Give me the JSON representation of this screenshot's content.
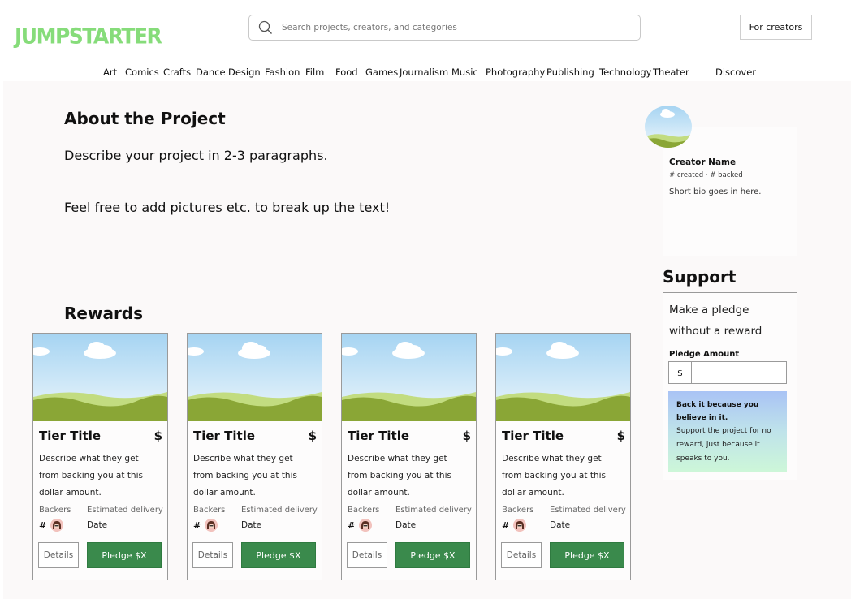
{
  "brand": {
    "logo": "JUMPSTARTER",
    "logo_color": "#86dc7a"
  },
  "search": {
    "placeholder": "Search projects, creators, and categories"
  },
  "header": {
    "creators_button": "For creators"
  },
  "nav": {
    "categories": [
      "Art",
      "Comics",
      "Crafts",
      "Dance",
      "Design",
      "Fashion",
      "Film",
      "Food",
      "Games",
      "Journalism",
      "Music",
      "Photography",
      "Publishing",
      "Technology",
      "Theater"
    ],
    "discover": "Discover"
  },
  "about": {
    "title": "About the Project",
    "paragraph1": "Describe your project in 2-3 paragraphs.",
    "paragraph2": "Feel free to add pictures etc. to break up the text!"
  },
  "rewards": {
    "title": "Rewards",
    "cards": [
      {
        "tier_title": "Tier Title",
        "price": "$",
        "description": "Describe what they get from backing you at this dollar amount.",
        "backers_label": "Backers",
        "backers_value": "#",
        "delivery_label": "Estimated delivery",
        "delivery_value": "Date",
        "details_label": "Details",
        "pledge_label": "Pledge $X"
      },
      {
        "tier_title": "Tier Title",
        "price": "$",
        "description": "Describe what they get from backing you at this dollar amount.",
        "backers_label": "Backers",
        "backers_value": "#",
        "delivery_label": "Estimated delivery",
        "delivery_value": "Date",
        "details_label": "Details",
        "pledge_label": "Pledge $X"
      },
      {
        "tier_title": "Tier Title",
        "price": "$",
        "description": "Describe what they get from backing you at this dollar amount.",
        "backers_label": "Backers",
        "backers_value": "#",
        "delivery_label": "Estimated delivery",
        "delivery_value": "Date",
        "details_label": "Details",
        "pledge_label": "Pledge $X"
      },
      {
        "tier_title": "Tier Title",
        "price": "$",
        "description": "Describe what they get from backing you at this dollar amount.",
        "backers_label": "Backers",
        "backers_value": "#",
        "delivery_label": "Estimated delivery",
        "delivery_value": "Date",
        "details_label": "Details",
        "pledge_label": "Pledge $X"
      }
    ]
  },
  "creator": {
    "name": "Creator Name",
    "stats": "# created · # backed",
    "bio": "Short bio goes in here."
  },
  "support": {
    "title": "Support",
    "text": "Make a pledge without a reward",
    "pledge_amount_label": "Pledge Amount",
    "currency": "$",
    "back_title": "Back it because you believe in it.",
    "back_text": "Support the project for no reward, just because it speaks to you."
  },
  "colors": {
    "pledge_button": "#3a8a4c",
    "hill_green": "#8aa636"
  }
}
